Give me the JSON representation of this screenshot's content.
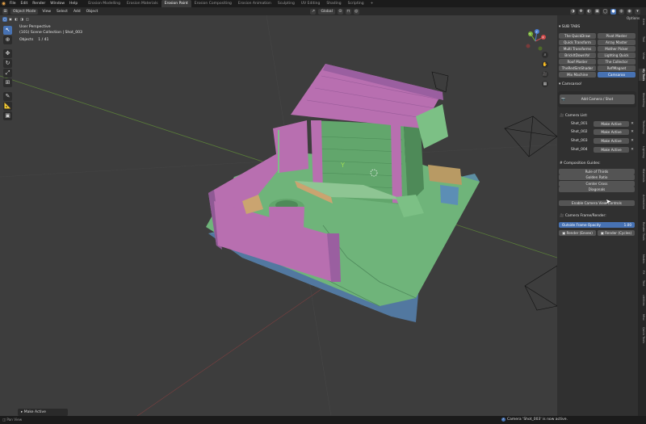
{
  "menubar": {
    "menus": [
      "File",
      "Edit",
      "Render",
      "Window",
      "Help"
    ],
    "workspaces": [
      "Erosion Modelling",
      "Erosion Materials",
      "Erosion Paint",
      "Erosion Compositing",
      "Erosion Animation",
      "Sculpting",
      "UV Editing",
      "Shading",
      "Scripting"
    ],
    "active_workspace": "Erosion Paint",
    "add_tab": "+"
  },
  "vpheader": {
    "mode": "Object Mode",
    "menus": [
      "View",
      "Select",
      "Add",
      "Object"
    ],
    "orientation": "Global",
    "options": "Options"
  },
  "viewport": {
    "view_name": "User Perspective",
    "collection": "(101) Scene Collection | Shot_003",
    "objects_label": "Objects",
    "objects_count": "1 / 41",
    "gizmo_axes": {
      "x": "X",
      "y": "Y",
      "z": "Z"
    }
  },
  "colors": {
    "accent": "#4772b3",
    "ground": "#6fb47a",
    "fence": "#b86fb0",
    "roof": "#b86fb0",
    "wall": "#62a66c",
    "base_side": "#5d8fa3"
  },
  "npanel": {
    "subtabs_title": "SUB TABS",
    "subtabs": [
      [
        "The QuickDraw",
        "Pivot Master"
      ],
      [
        "Quick Transform",
        "Array Master"
      ],
      [
        "Multi Transforms",
        "Mother Picker"
      ],
      [
        "BrickItDownYo!",
        "Lighting Quick"
      ],
      [
        "Roof Master",
        "The Collector"
      ],
      [
        "TheRedSimShader",
        "ReflMagnet"
      ],
      [
        "Mix Machine",
        "Camsaroo"
      ]
    ],
    "active_subtab": "Camsaroo",
    "camsaroo_title": "Camsaroo!",
    "add_camera": "Add Camera / Shot",
    "camera_list_title": "Camera List:",
    "cameras": [
      {
        "name": "Shot_001",
        "action": "Make Active"
      },
      {
        "name": "Shot_002",
        "action": "Make Active"
      },
      {
        "name": "Shot_003",
        "action": "Make Active"
      },
      {
        "name": "Shot_004",
        "action": "Make Active"
      }
    ],
    "remove_glyph": "✕",
    "composition_title": "Composition Guides:",
    "guides": [
      "Rule of Thirds",
      "Golden Ratio",
      "Center Cross",
      "Diagonals"
    ],
    "view_controls": "Enable Camera View Controls",
    "frame_render_title": "Camera Frame/Render:",
    "opacity_label": "Outside Frame Opacity",
    "opacity_value": "1.00",
    "render_eevee": "Render (Eevee)",
    "render_cycles": "Render (Cycles)"
  },
  "tabstrip": [
    "Item",
    "Tool",
    "View",
    "My Tools",
    "Modelling",
    "Texturing",
    "Lighting",
    "Materials",
    "Animation",
    "Render Tools",
    "Nodes",
    "FX",
    "Text",
    "Utilities",
    "Misc",
    "Quick Tools"
  ],
  "active_tab": "My Tools",
  "lastop": "Make Active",
  "statusbar": {
    "left": "Pan View",
    "message": "Camera 'Shot_003' is now active.",
    "ok_glyph": "✓"
  }
}
